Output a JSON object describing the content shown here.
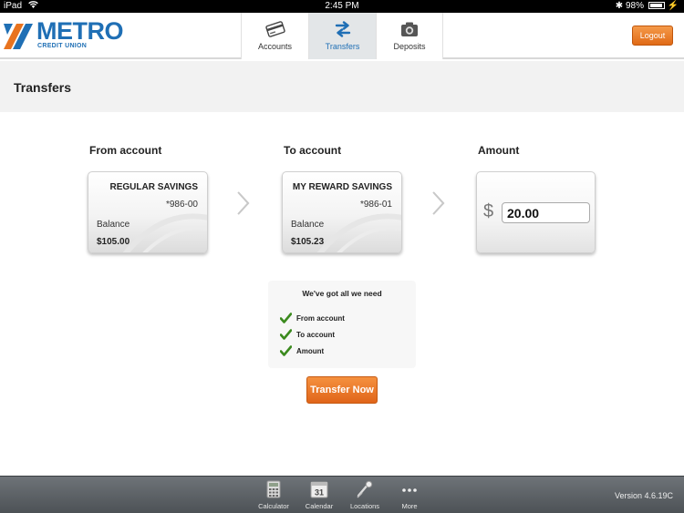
{
  "status_bar": {
    "device": "iPad",
    "time": "2:45 PM",
    "battery": "98%",
    "battery_level": 0.98
  },
  "header": {
    "logo_word": "METRO",
    "logo_sub": "CREDIT UNION",
    "tabs": [
      {
        "label": "Accounts",
        "icon": "credit-card-icon",
        "active": false
      },
      {
        "label": "Transfers",
        "icon": "transfer-arrows-icon",
        "active": true
      },
      {
        "label": "Deposits",
        "icon": "camera-icon",
        "active": false
      }
    ],
    "logout_label": "Logout"
  },
  "page": {
    "title": "Transfers"
  },
  "from_account": {
    "heading": "From account",
    "name": "REGULAR SAVINGS",
    "number": "*986-00",
    "balance_label": "Balance",
    "balance": "$105.00"
  },
  "to_account": {
    "heading": "To account",
    "name": "MY REWARD SAVINGS",
    "number": "*986-01",
    "balance_label": "Balance",
    "balance": "$105.23"
  },
  "amount": {
    "heading": "Amount",
    "currency_symbol": "$",
    "value": "20.00"
  },
  "checklist": {
    "title": "We've got all we need",
    "items": [
      "From account",
      "To account",
      "Amount"
    ]
  },
  "transfer_button": "Transfer Now",
  "toolbar": {
    "items": [
      {
        "label": "Calculator",
        "icon": "calculator-icon"
      },
      {
        "label": "Calendar",
        "icon": "calendar-icon",
        "day": "31"
      },
      {
        "label": "Locations",
        "icon": "map-pin-icon"
      },
      {
        "label": "More",
        "icon": "more-dots-icon"
      }
    ],
    "version": "Version 4.6.19C"
  },
  "colors": {
    "brand_blue": "#1f6fb5",
    "accent_orange": "#e8731f",
    "check_green": "#3b8a1e"
  }
}
